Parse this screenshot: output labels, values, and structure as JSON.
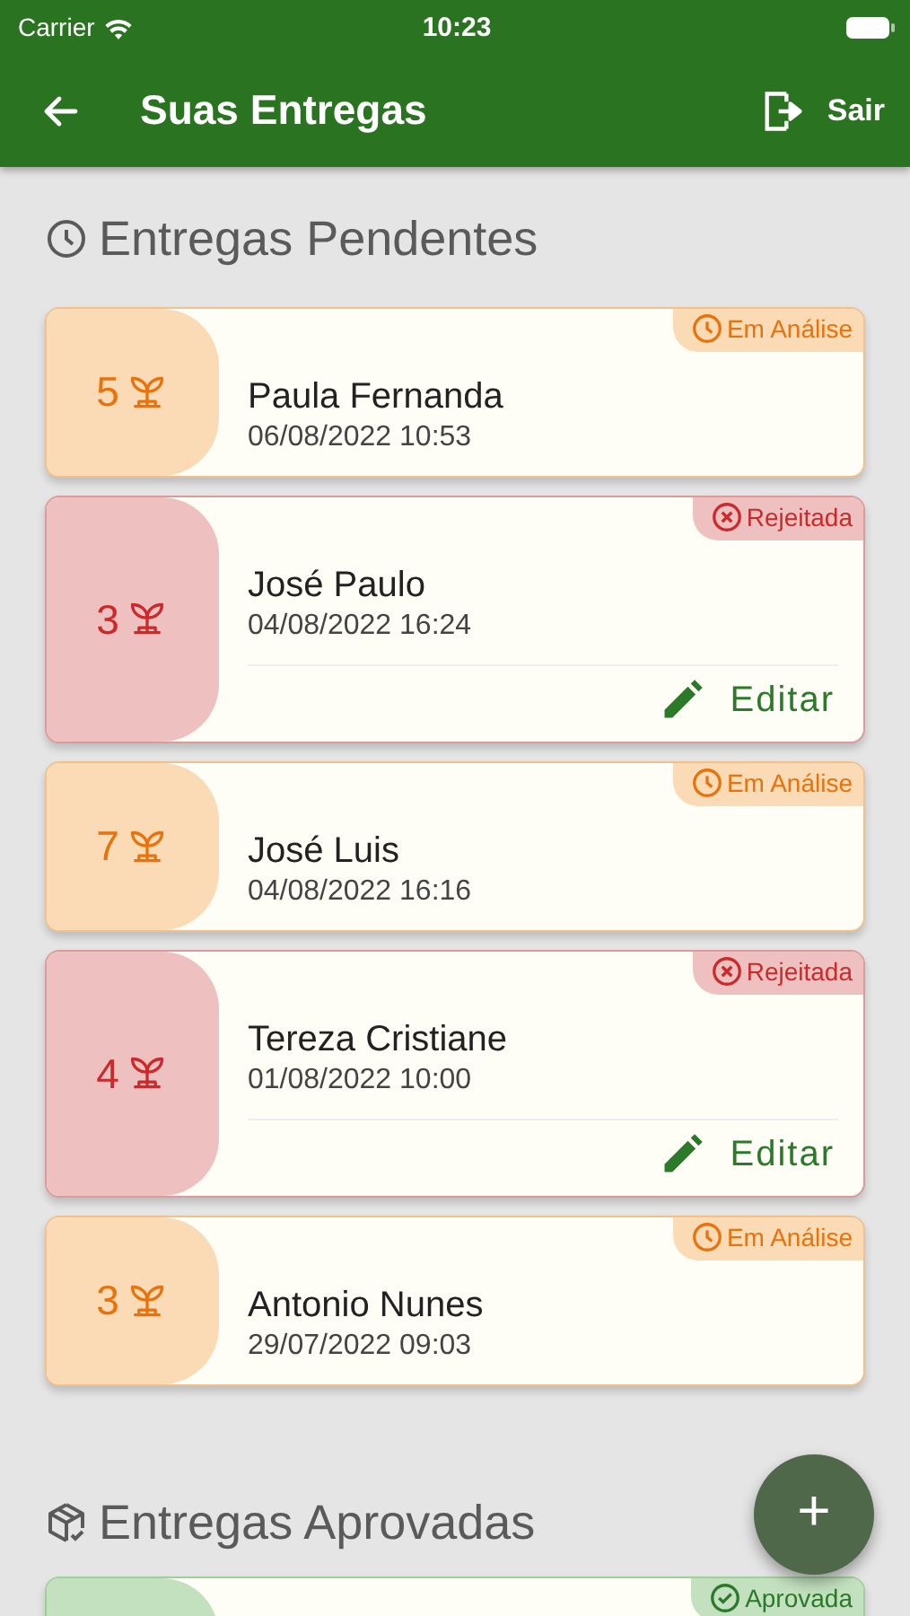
{
  "status_bar": {
    "carrier": "Carrier",
    "time": "10:23"
  },
  "app_bar": {
    "title": "Suas Entregas",
    "action": "Sair"
  },
  "sections": [
    {
      "kind": "pending",
      "title": "Entregas Pendentes",
      "cards": [
        {
          "kind": "analise",
          "badge": "Em Análise",
          "count": "5",
          "name": "Paula Fernanda",
          "date": "06/08/2022 10:53"
        },
        {
          "kind": "rejeitada",
          "badge": "Rejeitada",
          "count": "3",
          "name": "José Paulo",
          "date": "04/08/2022 16:24",
          "action": "Editar"
        },
        {
          "kind": "analise",
          "badge": "Em Análise",
          "count": "7",
          "name": "José Luis",
          "date": "04/08/2022 16:16"
        },
        {
          "kind": "rejeitada",
          "badge": "Rejeitada",
          "count": "4",
          "name": "Tereza Cristiane",
          "date": "01/08/2022 10:00",
          "action": "Editar"
        },
        {
          "kind": "analise",
          "badge": "Em Análise",
          "count": "3",
          "name": "Antonio Nunes",
          "date": "29/07/2022 09:03"
        }
      ]
    },
    {
      "kind": "approved",
      "title": "Entregas Aprovadas",
      "cards": [
        {
          "kind": "aprovada",
          "badge": "Aprovada"
        }
      ]
    }
  ],
  "fab": {
    "label": "+"
  }
}
